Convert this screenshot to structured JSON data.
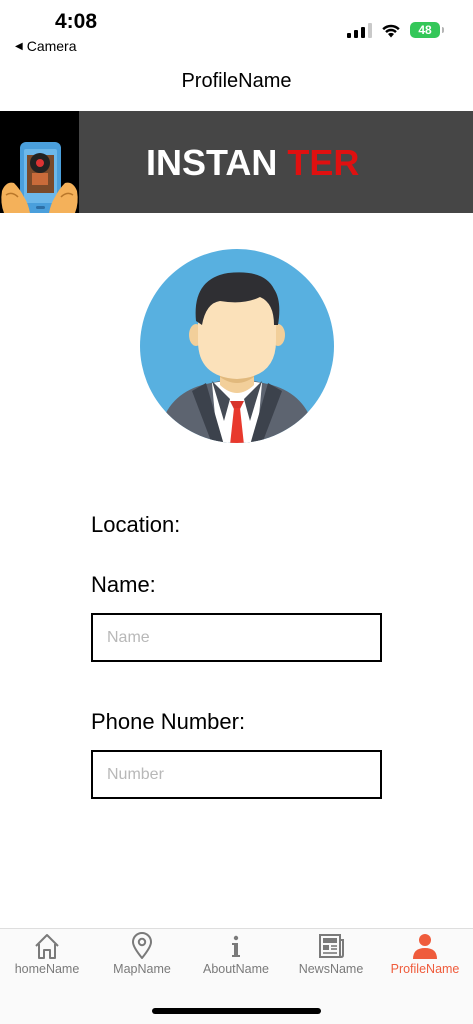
{
  "status_bar": {
    "time": "4:08",
    "back_app": "Camera",
    "battery": "48"
  },
  "nav": {
    "title": "ProfileName"
  },
  "banner": {
    "text_white": "INSTAN",
    "text_red": "TER",
    "colors": {
      "background": "#464646",
      "red": "#e01010"
    }
  },
  "form": {
    "location_label": "Location:",
    "name_label": "Name:",
    "name_placeholder": "Name",
    "phone_label": "Phone Number:",
    "phone_placeholder": "Number"
  },
  "tabs": [
    {
      "label": "homeName",
      "icon": "home-icon"
    },
    {
      "label": "MapName",
      "icon": "map-pin-icon"
    },
    {
      "label": "AboutName",
      "icon": "info-icon"
    },
    {
      "label": "NewsName",
      "icon": "newspaper-icon"
    },
    {
      "label": "ProfileName",
      "icon": "person-icon",
      "active": true
    }
  ],
  "colors": {
    "active_tab": "#ef5c3c",
    "inactive_tab": "#7a7a7a"
  }
}
